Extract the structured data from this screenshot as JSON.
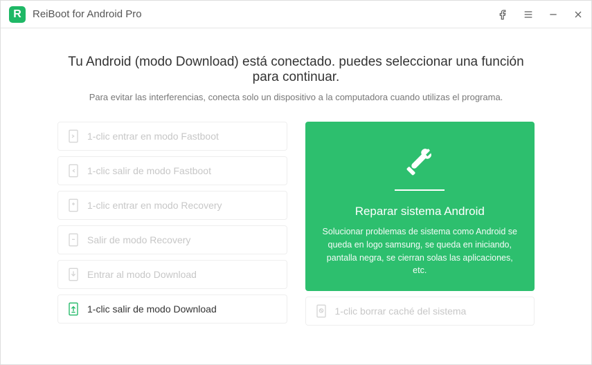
{
  "titlebar": {
    "app_title": "ReiBoot for Android Pro",
    "logo_letter": "R"
  },
  "main": {
    "headline": "Tu Android (modo Download) está conectado. puedes seleccionar una función para continuar.",
    "subtitle": "Para evitar las interferencias, conecta solo un dispositivo a la computadora cuando utilizas el programa."
  },
  "options": [
    {
      "label": "1-clic entrar en modo Fastboot",
      "icon": "phone-enter",
      "active": false
    },
    {
      "label": "1-clic salir de modo Fastboot",
      "icon": "phone-exit",
      "active": false
    },
    {
      "label": "1-clic entrar en modo Recovery",
      "icon": "phone-enter",
      "active": false
    },
    {
      "label": "Salir de modo Recovery",
      "icon": "phone-exit",
      "active": false
    },
    {
      "label": "Entrar al modo Download",
      "icon": "phone-download",
      "active": false
    },
    {
      "label": "1-clic salir de modo Download",
      "icon": "phone-download-exit",
      "active": true
    }
  ],
  "repair": {
    "title": "Reparar sistema Android",
    "description": "Solucionar problemas de sistema como Android se queda en logo samsung, se queda en iniciando, pantalla negra, se cierran solas las aplicaciones, etc."
  },
  "cache": {
    "label": "1-clic borrar caché del sistema"
  }
}
